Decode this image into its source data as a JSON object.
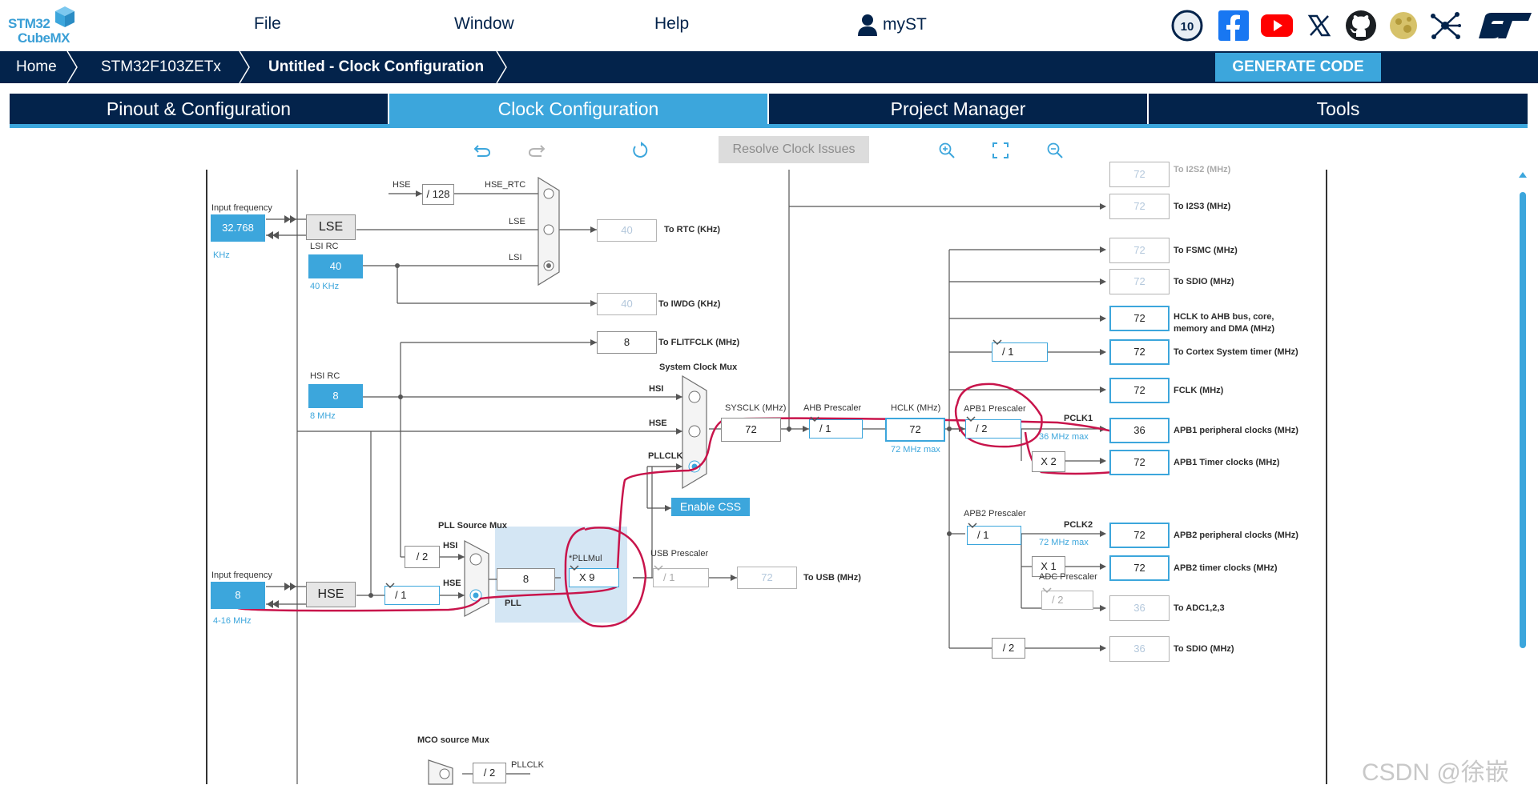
{
  "app": {
    "logo_line1": "STM32",
    "logo_line2": "CubeMX",
    "menu": [
      "File",
      "Window",
      "Help"
    ],
    "account": "myST",
    "social_icons": [
      "anniversary-10-icon",
      "facebook-icon",
      "youtube-icon",
      "x-icon",
      "github-icon",
      "community-icon",
      "network-icon",
      "st-logo-icon"
    ]
  },
  "breadcrumb": {
    "home": "Home",
    "device": "STM32F103ZETx",
    "page": "Untitled - Clock Configuration"
  },
  "generate_label": "GENERATE CODE",
  "tabs": [
    "Pinout & Configuration",
    "Clock Configuration",
    "Project Manager",
    "Tools"
  ],
  "active_tab": "Clock Configuration",
  "toolbar": {
    "resolve_label": "Resolve Clock Issues",
    "icons": [
      "undo-icon",
      "redo-icon",
      "reset-icon",
      "zoom-in-icon",
      "fit-icon",
      "zoom-out-icon"
    ]
  },
  "colors": {
    "navy": "#03234b",
    "accent": "#3ca6dc",
    "annotation": "#c8144b"
  },
  "clock": {
    "lse": {
      "input_label": "Input frequency",
      "value": "32.768",
      "unit": "KHz",
      "name": "LSE"
    },
    "lsi": {
      "label": "LSI RC",
      "value": "40",
      "unit": "40 KHz"
    },
    "rtc_mux": {
      "hse_label": "HSE",
      "div": "/ 128",
      "hse_rtc_label": "HSE_RTC",
      "lse_label": "LSE",
      "lsi_label": "LSI",
      "rtc_value": "40",
      "rtc_label": "To RTC (KHz)"
    },
    "iwdg": {
      "value": "40",
      "label": "To IWDG (KHz)"
    },
    "flitfclk": {
      "value": "8",
      "label": "To FLITFCLK (MHz)"
    },
    "hsi": {
      "label": "HSI RC",
      "value": "8",
      "unit": "8 MHz"
    },
    "hse": {
      "input_label": "Input frequency",
      "value": "8",
      "unit": "4-16 MHz",
      "name": "HSE",
      "prediv": "/ 1"
    },
    "pll_source": {
      "title": "PLL Source Mux",
      "hsi_div": "/ 2",
      "hsi_label": "HSI",
      "hse_label": "HSE"
    },
    "pll": {
      "label": "PLL",
      "input": "8",
      "mul_label": "*PLLMul",
      "mul": "X 9"
    },
    "usb": {
      "title": "USB Prescaler",
      "div": "/ 1",
      "value": "72",
      "label": "To USB (MHz)"
    },
    "sysclk_mux": {
      "title": "System Clock Mux",
      "hsi": "HSI",
      "hse": "HSE",
      "pllclk": "PLLCLK",
      "css": "Enable CSS"
    },
    "sysclk": {
      "label": "SYSCLK (MHz)",
      "value": "72"
    },
    "ahb": {
      "label": "AHB Prescaler",
      "div": "/ 1"
    },
    "hclk": {
      "label": "HCLK (MHz)",
      "value": "72",
      "max": "72 MHz max"
    },
    "apb1": {
      "label": "APB1 Prescaler",
      "div": "/ 2",
      "max": "36 MHz max",
      "pclk": "PCLK1",
      "timer_mul": "X 2"
    },
    "apb2": {
      "label": "APB2 Prescaler",
      "div": "/ 1",
      "max": "72 MHz max",
      "pclk": "PCLK2",
      "timer_mul": "X 1"
    },
    "adc": {
      "label": "ADC Prescaler",
      "div": "/ 2"
    },
    "cortex_div": "/ 1",
    "sdio_div": "/ 2",
    "outputs": {
      "i2s2": {
        "value": "72",
        "label": "To I2S2 (MHz)"
      },
      "i2s3": {
        "value": "72",
        "label": "To I2S3 (MHz)"
      },
      "fsmc": {
        "value": "72",
        "label": "To FSMC (MHz)"
      },
      "sdio1": {
        "value": "72",
        "label": "To SDIO (MHz)"
      },
      "hclk_ahb": {
        "value": "72",
        "label1": "HCLK to AHB bus, core,",
        "label2": "memory and DMA (MHz)"
      },
      "cortex": {
        "value": "72",
        "label": "To Cortex System timer (MHz)"
      },
      "fclk": {
        "value": "72",
        "label": "FCLK (MHz)"
      },
      "apb1_periph": {
        "value": "36",
        "label": "APB1 peripheral clocks (MHz)"
      },
      "apb1_timer": {
        "value": "72",
        "label": "APB1 Timer clocks (MHz)"
      },
      "apb2_periph": {
        "value": "72",
        "label": "APB2 peripheral clocks (MHz)"
      },
      "apb2_timer": {
        "value": "72",
        "label": "APB2 timer clocks (MHz)"
      },
      "adc": {
        "value": "36",
        "label": "To ADC1,2,3"
      },
      "sdio2": {
        "value": "36",
        "label": "To SDIO (MHz)"
      }
    },
    "mco": {
      "title": "MCO source Mux",
      "div": "/ 2",
      "pllclk": "PLLCLK"
    }
  },
  "watermark": "CSDN @徐嵌"
}
